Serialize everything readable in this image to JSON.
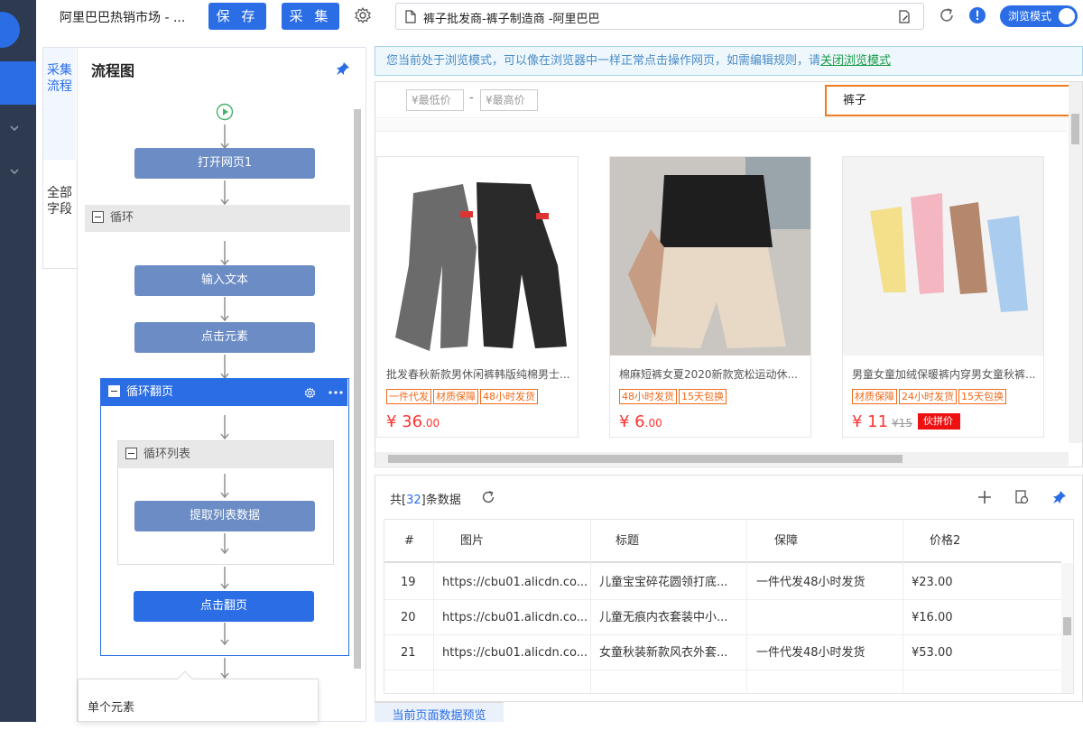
{
  "toolbar": {
    "title": "阿里巴巴热销市场 - ...",
    "save_label": "保 存",
    "collect_label": "采 集",
    "url": "裤子批发商-裤子制造商 -阿里巴巴",
    "browse_mode_label": "浏览模式"
  },
  "side_tabs": [
    {
      "label": "采集流程"
    },
    {
      "label": "全部字段"
    }
  ],
  "flow": {
    "title": "流程图",
    "nodes": {
      "open_page": "打开网页1",
      "loop": "循环",
      "input_text": "输入文本",
      "click_element": "点击元素",
      "loop_paging": "循环翻页",
      "loop_list": "循环列表",
      "extract_list": "提取列表数据",
      "click_paging": "点击翻页"
    },
    "popup_label": "单个元素"
  },
  "notice": {
    "text": "您当前处于浏览模式，可以像在浏览器中一样正常点击操作网页，如需编辑规则，请",
    "link": "关闭浏览模式"
  },
  "web": {
    "price_min_placeholder": "¥最低价",
    "price_max_placeholder": "¥最高价",
    "separator": "-",
    "search_value": "裤子",
    "products": [
      {
        "title": "批发春秋新款男休闲裤韩版纯棉男士...",
        "tags": [
          "一件代发",
          "材质保障",
          "48小时发货"
        ],
        "price_int": "¥ 36",
        "price_dec": ".00",
        "old_price": "",
        "badge": ""
      },
      {
        "title": "棉麻短裤女夏2020新款宽松运动休...",
        "tags": [
          "48小时发货",
          "15天包换"
        ],
        "price_int": "¥ 6",
        "price_dec": ".00",
        "old_price": "",
        "badge": ""
      },
      {
        "title": "男童女童加绒保暖裤内穿男女童秋裤...",
        "tags": [
          "材质保障",
          "24小时发货",
          "15天包换"
        ],
        "price_int": "¥ 11",
        "price_dec": "",
        "old_price": "¥15",
        "badge": "伙拼价"
      }
    ]
  },
  "data_panel": {
    "count_prefix": "共[",
    "count": "32",
    "count_suffix": "]条数据",
    "columns": [
      "#",
      "图片",
      "标题",
      "保障",
      "价格2"
    ],
    "rows": [
      [
        "19",
        "https://cbu01.alicdn.co...",
        "儿童宝宝碎花圆领打底...",
        "一件代发48小时发货",
        "¥23.00"
      ],
      [
        "20",
        "https://cbu01.alicdn.co...",
        "儿童无痕内衣套装中小...",
        "",
        "¥16.00"
      ],
      [
        "21",
        "https://cbu01.alicdn.co...",
        "女童秋装新款风衣外套...",
        "一件代发48小时发货",
        "¥53.00"
      ]
    ],
    "preview_tab": "当前页面数据预览"
  },
  "colors": {
    "accent": "#2a6de5",
    "sidebar": "#2d3a4f",
    "price": "#ff3333",
    "tag": "#f06a1b"
  }
}
